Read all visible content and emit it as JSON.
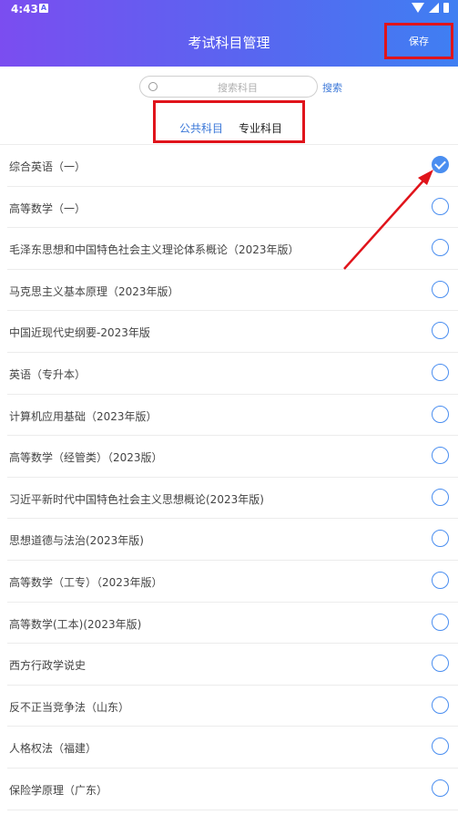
{
  "status_bar": {
    "time": "4:43",
    "notification_icon": "A"
  },
  "header": {
    "title": "考试科目管理",
    "save_label": "保存"
  },
  "search": {
    "placeholder": "搜索科目",
    "button_label": "搜索"
  },
  "tabs": [
    {
      "label": "公共科目",
      "active": true
    },
    {
      "label": "专业科目",
      "active": false
    }
  ],
  "subjects": [
    {
      "label": "综合英语（一）",
      "checked": true
    },
    {
      "label": "高等数学（一）",
      "checked": false
    },
    {
      "label": "毛泽东思想和中国特色社会主义理论体系概论（2023年版）",
      "checked": false
    },
    {
      "label": "马克思主义基本原理（2023年版）",
      "checked": false
    },
    {
      "label": "中国近现代史纲要-2023年版",
      "checked": false
    },
    {
      "label": "英语（专升本）",
      "checked": false
    },
    {
      "label": "计算机应用基础（2023年版）",
      "checked": false
    },
    {
      "label": "高等数学（经管类）（2023版）",
      "checked": false
    },
    {
      "label": "习近平新时代中国特色社会主义思想概论(2023年版)",
      "checked": false
    },
    {
      "label": "思想道德与法治(2023年版)",
      "checked": false
    },
    {
      "label": "高等数学（工专）（2023年版）",
      "checked": false
    },
    {
      "label": "高等数学(工本)(2023年版)",
      "checked": false
    },
    {
      "label": "西方行政学说史",
      "checked": false
    },
    {
      "label": "反不正当竞争法（山东）",
      "checked": false
    },
    {
      "label": "人格权法（福建）",
      "checked": false
    },
    {
      "label": "保险学原理（广东）",
      "checked": false
    }
  ],
  "colors": {
    "accent": "#4a8ef0",
    "header_start": "#7b4df0",
    "header_end": "#3f7ff2",
    "highlight": "#e0141b"
  }
}
